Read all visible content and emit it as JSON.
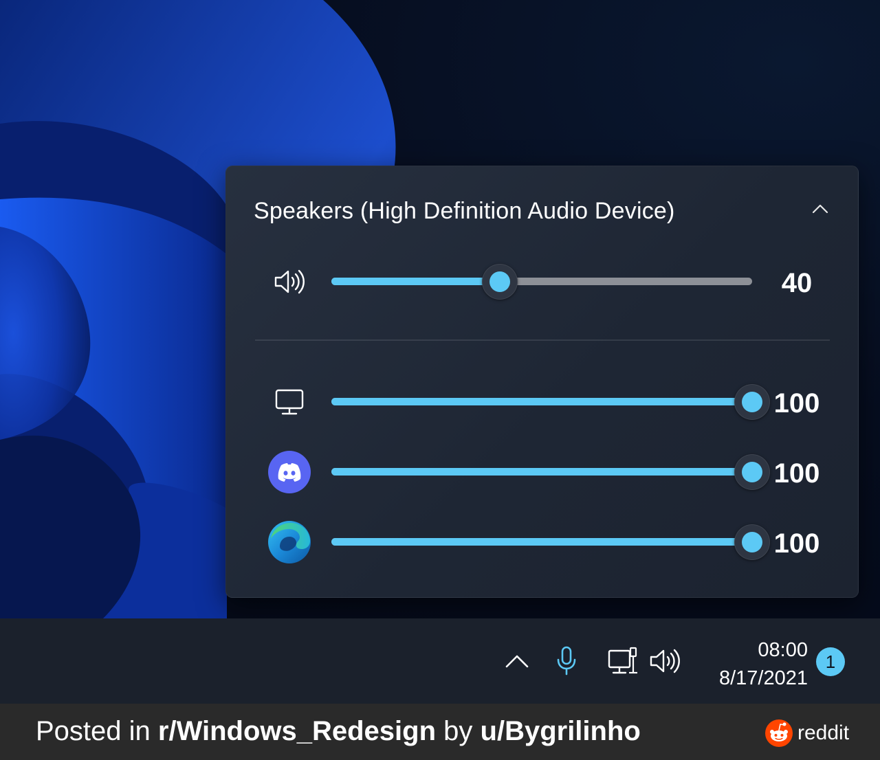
{
  "flyout": {
    "device_name": "Speakers (High Definition Audio Device)",
    "master": {
      "icon": "speaker-icon",
      "value": 40,
      "value_label": "40"
    },
    "apps": [
      {
        "name": "system-sounds",
        "icon": "monitor-icon",
        "value": 100,
        "value_label": "100"
      },
      {
        "name": "discord",
        "icon": "discord-icon",
        "value": 100,
        "value_label": "100"
      },
      {
        "name": "edge",
        "icon": "edge-icon",
        "value": 100,
        "value_label": "100"
      }
    ],
    "accent_color": "#5cc9f5"
  },
  "taskbar": {
    "tray_icons": [
      "chevron-up-icon",
      "microphone-icon",
      "network-icon",
      "speaker-icon"
    ],
    "time": "08:00",
    "date": "8/17/2021",
    "notification_count": "1"
  },
  "footer": {
    "posted_in": "Posted in ",
    "subreddit": "r/Windows_Redesign",
    "by": " by ",
    "user": "u/Bygrilinho",
    "brand": "reddit",
    "brand_color": "#ff4500"
  }
}
